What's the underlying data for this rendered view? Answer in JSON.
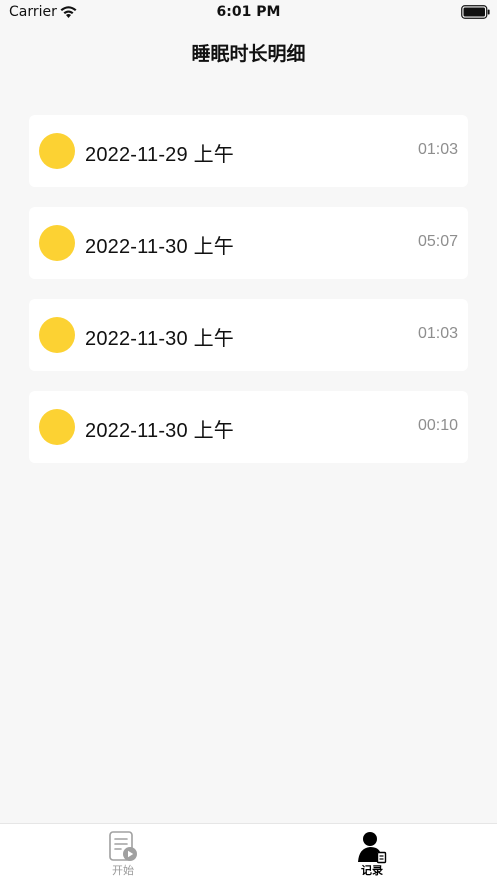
{
  "status_bar": {
    "carrier": "Carrier",
    "time": "6:01 PM"
  },
  "header": {
    "title": "睡眠时长明细"
  },
  "records": [
    {
      "date": "2022-11-29 上午",
      "duration": "01:03"
    },
    {
      "date": "2022-11-30 上午",
      "duration": "05:07"
    },
    {
      "date": "2022-11-30 上午",
      "duration": "01:03"
    },
    {
      "date": "2022-11-30 上午",
      "duration": "00:10"
    }
  ],
  "tab_bar": {
    "tabs": [
      {
        "label": "开始",
        "icon": "document-play-icon",
        "active": false
      },
      {
        "label": "记录",
        "icon": "person-record-icon",
        "active": true
      }
    ]
  },
  "colors": {
    "accent_dot": "#fcd233",
    "background": "#f7f7f7",
    "card": "#ffffff",
    "secondary_text": "#8e8e8e"
  }
}
